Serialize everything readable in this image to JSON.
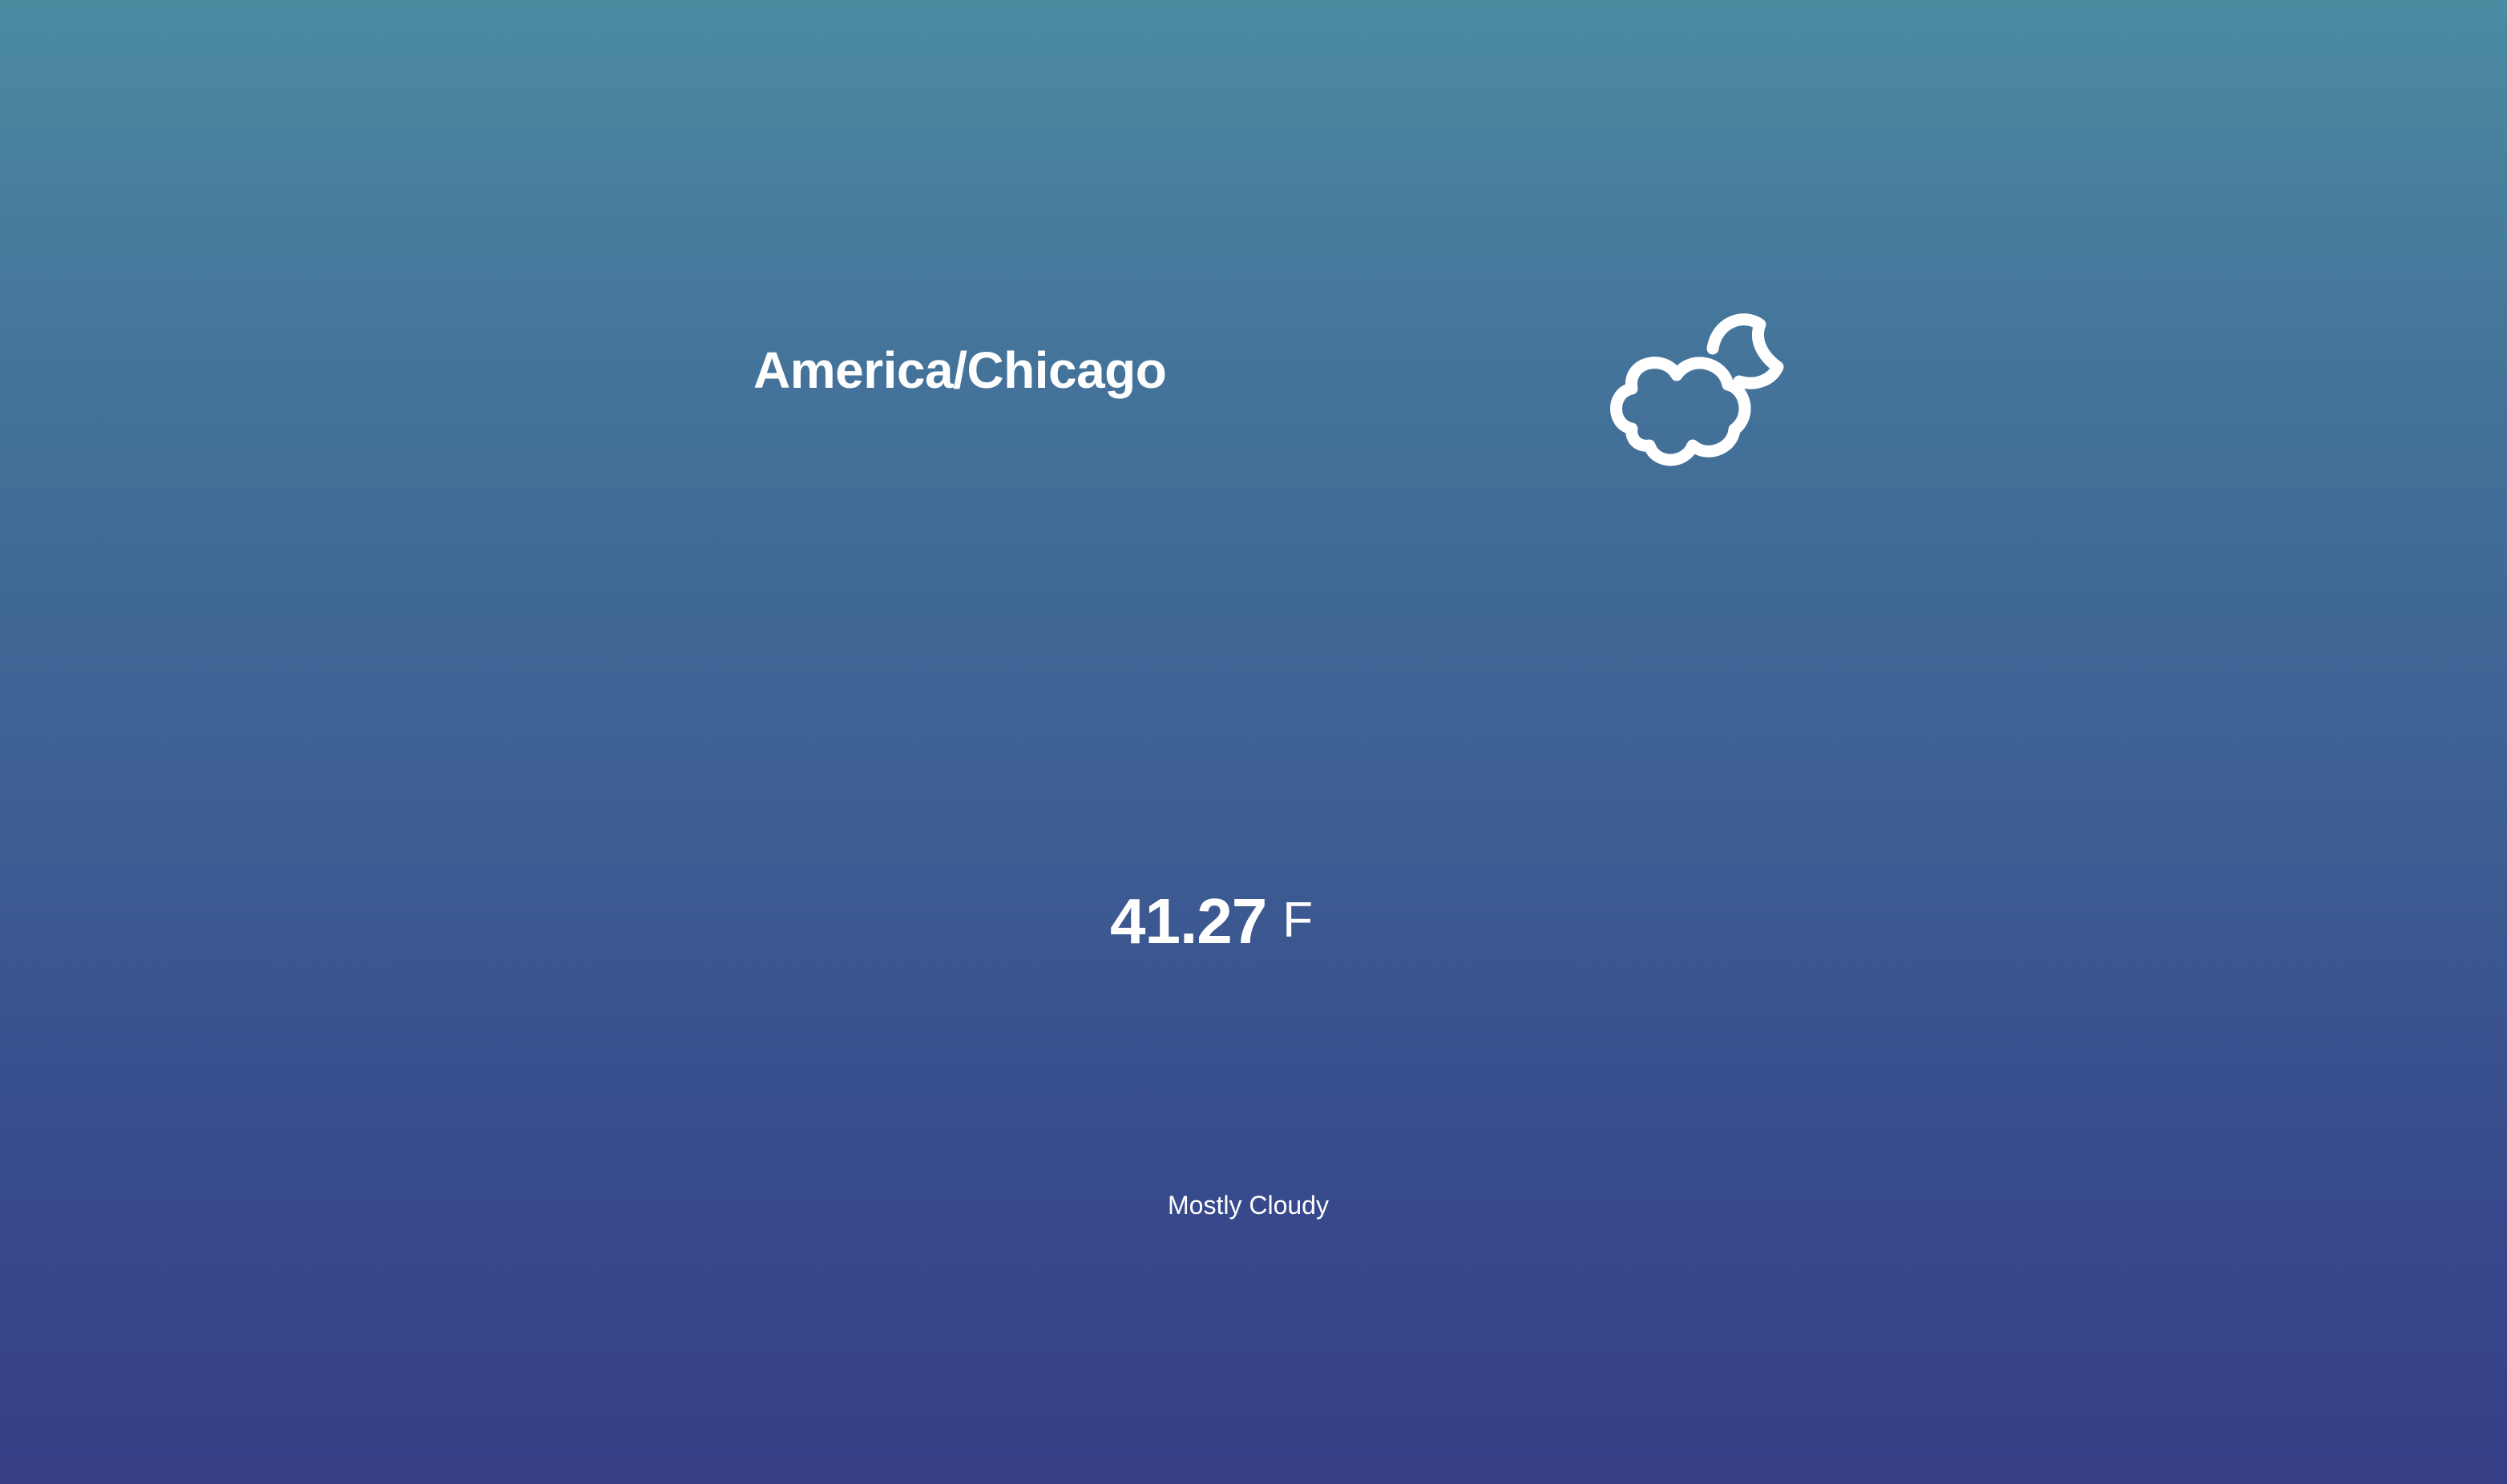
{
  "location": {
    "name": "America/Chicago"
  },
  "weather": {
    "icon": "cloudy-night-icon",
    "temperature": "41.27",
    "unit": "F",
    "condition": "Mostly Cloudy"
  },
  "colors": {
    "gradient_top": "#4b8ba0",
    "gradient_bottom": "#363e86",
    "text": "#ffffff"
  }
}
